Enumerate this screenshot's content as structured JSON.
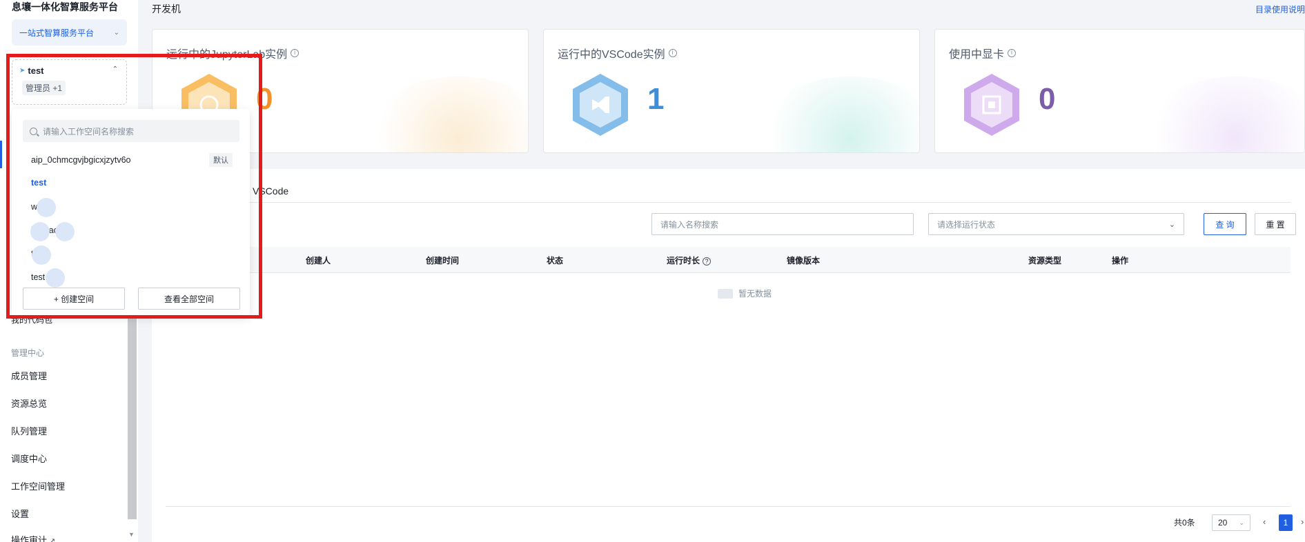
{
  "sidebar": {
    "brand": "息壤一体化智算服务平台",
    "platform_select": "一站式智算服务平台",
    "workspace_card": {
      "name": "test",
      "role": "管理员 +1"
    },
    "behind_text": "我的代码包",
    "section_title": "管理中心",
    "items": [
      {
        "label": "成员管理"
      },
      {
        "label": "资源总览"
      },
      {
        "label": "队列管理"
      },
      {
        "label": "调度中心"
      },
      {
        "label": "工作空间管理"
      },
      {
        "label": "设置"
      },
      {
        "label": "操作审计"
      }
    ]
  },
  "header": {
    "title": "开发机",
    "help_link": "目录使用说明"
  },
  "stats": [
    {
      "title": "运行中的JupyterLab实例",
      "value": "0",
      "color": "#f0932b"
    },
    {
      "title": "运行中的VSCode实例",
      "value": "1",
      "color": "#3f8ed8"
    },
    {
      "title": "使用中显卡",
      "value": "0",
      "color": "#7b5ea7"
    }
  ],
  "tabs": {
    "vscode": "VSCode"
  },
  "filters": {
    "search_placeholder": "请输入名称搜索",
    "status_placeholder": "请选择运行状态",
    "query_btn": "查 询",
    "reset_btn": "重 置"
  },
  "table": {
    "columns": [
      "创建人",
      "创建时间",
      "状态",
      "运行时长",
      "镜像版本",
      "资源类型",
      "操作"
    ],
    "empty_text": "暂无数据"
  },
  "pagination": {
    "total": "共0条",
    "page_size": "20",
    "current": "1"
  },
  "popup": {
    "search_placeholder": "请输入工作空间名称搜索",
    "default_tag": "默认",
    "workspaces": [
      {
        "name": "aip_0chmcgvjbgicxjzytv6o"
      },
      {
        "name": "test"
      },
      {
        "name": "w   ni"
      },
      {
        "name": "l    w    pace2"
      },
      {
        "name": "t"
      },
      {
        "name": "test   607"
      }
    ],
    "create_btn": "+ 创建空间",
    "view_all_btn": "查看全部空间"
  },
  "colors": {
    "accent": "#1f5fe0",
    "highlight": "#e31b1b"
  }
}
